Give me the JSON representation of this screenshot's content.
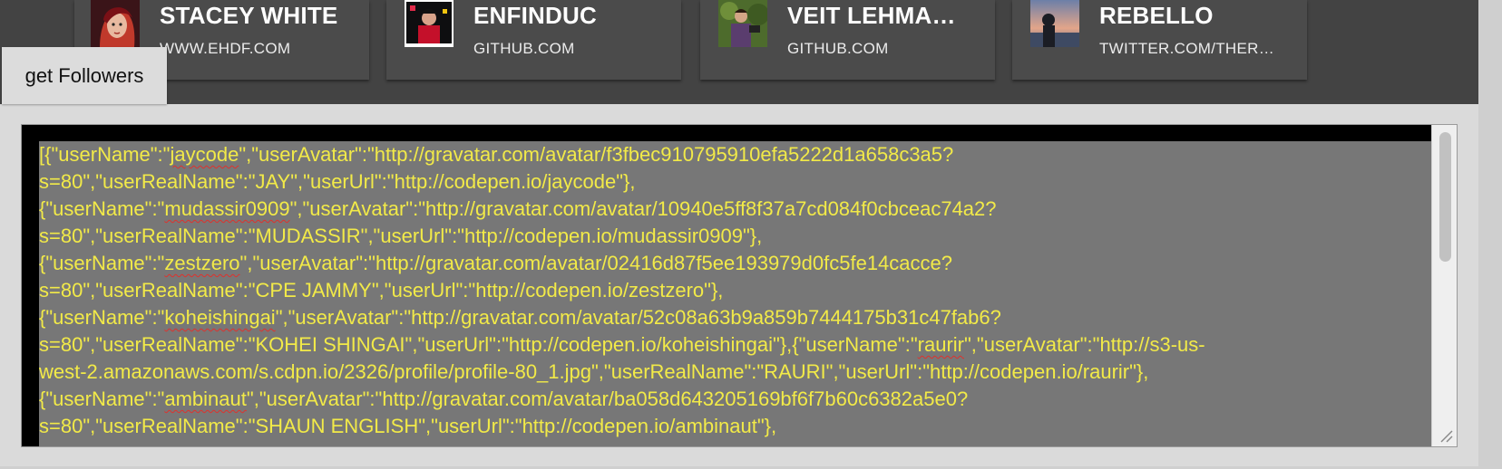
{
  "cards": [
    {
      "name": "STACEY WHITE",
      "site": "WWW.EHDF.COM",
      "avatar_icon": "stacey-white-avatar"
    },
    {
      "name": "ENFINDUC",
      "site": "GITHUB.COM",
      "avatar_icon": "enfinduc-avatar"
    },
    {
      "name": "VEIT LEHMA…",
      "site": "GITHUB.COM",
      "avatar_icon": "veit-lehmann-avatar"
    },
    {
      "name": "REBELLO",
      "site": "TWITTER.COM/THER…",
      "avatar_icon": "rebello-avatar"
    }
  ],
  "button": {
    "label": "get Followers"
  },
  "output": {
    "lines": [
      "[{\"userName\":\"jaycode\",\"userAvatar\":\"http://gravatar.com/avatar/f3fbec910795910efa5222d1a658c3a5?",
      "s=80\",\"userRealName\":\"JAY\",\"userUrl\":\"http://codepen.io/jaycode\"},",
      "{\"userName\":\"mudassir0909\",\"userAvatar\":\"http://gravatar.com/avatar/10940e5ff8f37a7cd084f0cbceac74a2?",
      "s=80\",\"userRealName\":\"MUDASSIR\",\"userUrl\":\"http://codepen.io/mudassir0909\"},",
      "{\"userName\":\"zestzero\",\"userAvatar\":\"http://gravatar.com/avatar/02416d87f5ee193979d0fc5fe14cacce?",
      "s=80\",\"userRealName\":\"CPE JAMMY\",\"userUrl\":\"http://codepen.io/zestzero\"},",
      "{\"userName\":\"koheishingai\",\"userAvatar\":\"http://gravatar.com/avatar/52c08a63b9a859b7444175b31c47fab6?",
      "s=80\",\"userRealName\":\"KOHEI SHINGAI\",\"userUrl\":\"http://codepen.io/koheishingai\"},{\"userName\":\"raurir\",\"userAvatar\":\"http://s3-us-",
      "west-2.amazonaws.com/s.cdpn.io/2326/profile/profile-80_1.jpg\",\"userRealName\":\"RAURI\",\"userUrl\":\"http://codepen.io/raurir\"},",
      "{\"userName\":\"ambinaut\",\"userAvatar\":\"http://gravatar.com/avatar/ba058d643205169bf6f7b60c6382a5e0?",
      "s=80\",\"userRealName\":\"SHAUN ENGLISH\",\"userUrl\":\"http://codepen.io/ambinaut\"},"
    ],
    "spell_flagged": [
      "jaycode",
      "mudassir0909",
      "zestzero",
      "koheishingai",
      "raurir",
      "ambinaut"
    ]
  },
  "colors": {
    "topbar": "#434343",
    "card": "#4b4b4b",
    "output_text": "#f2ea48",
    "output_bg": "#777777",
    "frame": "#000000",
    "spell_underline": "#e0312c"
  }
}
